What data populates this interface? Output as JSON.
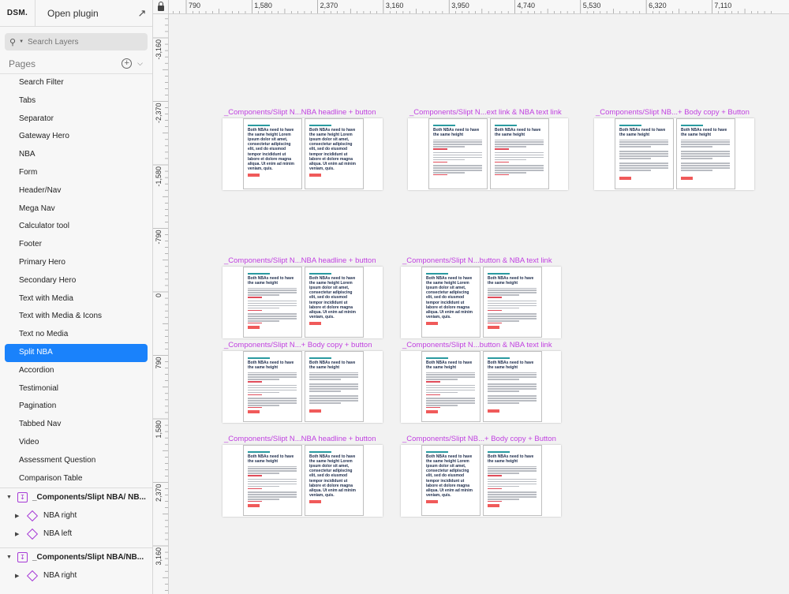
{
  "topbar": {
    "logo": "DSM.",
    "open_plugin": "Open plugin",
    "open_arrow": "↗"
  },
  "search": {
    "placeholder": "Search Layers"
  },
  "pages": {
    "title": "Pages",
    "items": [
      {
        "label": "Search Filter"
      },
      {
        "label": "Tabs"
      },
      {
        "label": "Separator"
      },
      {
        "label": "Gateway Hero"
      },
      {
        "label": "NBA"
      },
      {
        "label": "Form"
      },
      {
        "label": "Header/Nav"
      },
      {
        "label": "Mega Nav"
      },
      {
        "label": "Calculator tool"
      },
      {
        "label": "Footer"
      },
      {
        "label": "Primary Hero"
      },
      {
        "label": "Secondary Hero"
      },
      {
        "label": "Text with Media"
      },
      {
        "label": "Text with Media & Icons"
      },
      {
        "label": "Text no Media"
      },
      {
        "label": "Split NBA",
        "active": true
      },
      {
        "label": "Accordion"
      },
      {
        "label": "Testimonial"
      },
      {
        "label": "Pagination"
      },
      {
        "label": "Tabbed Nav"
      },
      {
        "label": "Video"
      },
      {
        "label": "Assessment Question"
      },
      {
        "label": "Comparison Table"
      }
    ]
  },
  "layers": {
    "group1": {
      "name": "_Components/Slipt NBA/ NB...",
      "children": [
        "NBA right",
        "NBA left"
      ]
    },
    "group2": {
      "name": "_Components/Slipt NBA/NB...",
      "children": [
        "NBA right"
      ]
    }
  },
  "rulers": {
    "top": [
      "790",
      "1,580",
      "2,370",
      "3,160",
      "3,950",
      "4,740",
      "5,530",
      "6,320",
      "7,110"
    ],
    "left": [
      "-3,160",
      "-2,370",
      "-1,580",
      "-790",
      "0",
      "790",
      "1,580",
      "2,370",
      "3,160"
    ]
  },
  "canvas": {
    "artboards": [
      {
        "title": "_Components/Slipt N...NBA headline + button"
      },
      {
        "title": "_Components/Slipt N...ext link & NBA text link"
      },
      {
        "title": "_Components/Slipt NB...+ Body copy + Button"
      },
      {
        "title": "_Components/Slipt N...NBA headline + button"
      },
      {
        "title": "_Components/Slipt N...button & NBA text link"
      },
      {
        "title": "_Components/Slipt N...+ Body copy + button"
      },
      {
        "title": "_Components/Slipt N...button & NBA text link"
      },
      {
        "title": "_Components/Slipt N...NBA headline + button"
      },
      {
        "title": "_Components/Slipt NB...+ Body copy + Button"
      }
    ],
    "card_heading": "Both NBAs need to have the same height",
    "card_long_heading": "Both NBAs need to have the same height Lorem ipsum dolor sit amet, consectetur adipiscing elit, sed do eiusmod tempor incididunt ut labore et dolore magna aliqua. Ut enim ad minim veniam, quis.",
    "colors": {
      "title": "#c03fe0",
      "accent": "#1a82fb",
      "button": "#f05a5a",
      "symbol": "#a63bd6"
    }
  }
}
